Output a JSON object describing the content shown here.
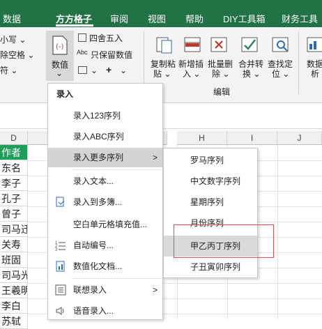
{
  "tabs": [
    "数据",
    "方方格子",
    "审阅",
    "视图",
    "帮助",
    "DIY工具箱",
    "财务工具"
  ],
  "active_tab": "方方格子",
  "ribbon": {
    "left_partial": [
      "小写 ⌄",
      "除空格 ⌄",
      "符 ⌄"
    ],
    "value_button": {
      "label": "数值",
      "dropdown": "⌄"
    },
    "round_label": "四舍五入",
    "keep_value_label": "只保留数值",
    "plus": "+",
    "copy_paste": [
      "复制粘",
      "贴 ⌄"
    ],
    "insert": [
      "新增插",
      "入 ⌄"
    ],
    "batch_delete": [
      "批量删",
      "除 ⌄"
    ],
    "merge_convert": [
      "合并转",
      "换 ⌄"
    ],
    "find_locate": [
      "查找定",
      "位 ⌄"
    ],
    "data_analysis": [
      "数据",
      "析"
    ],
    "group_edit": "编辑"
  },
  "columns": [
    "D",
    "H",
    "I",
    "J"
  ],
  "cells": [
    "作者",
    "东名",
    "李子",
    "孔子",
    "曾子",
    "司马迁",
    "关寿",
    "班固",
    "司马光",
    "王羲明",
    "李白",
    "苏轼"
  ],
  "menu": {
    "header": "录入",
    "items": [
      {
        "label": "录入123序列"
      },
      {
        "label": "录入ABC序列"
      },
      {
        "label": "录入更多序列",
        "arrow": ">"
      },
      {
        "label": "录入文本..."
      },
      {
        "label": "录入到多簿..."
      },
      {
        "label": "空白单元格填充值..."
      },
      {
        "label": "自动编号..."
      },
      {
        "label": "数值化文档..."
      },
      {
        "label": "联想录入",
        "arrow": ">"
      },
      {
        "label": "语音录入..."
      }
    ]
  },
  "submenu": {
    "items": [
      "罗马序列",
      "中文数字序列",
      "星期序列",
      "月份序列",
      "甲乙丙丁序列",
      "子丑寅卯序列"
    ]
  },
  "colors": {
    "accent": "#217346",
    "header_cell": "#1f9e5b",
    "highlight_box": "#e05050"
  }
}
